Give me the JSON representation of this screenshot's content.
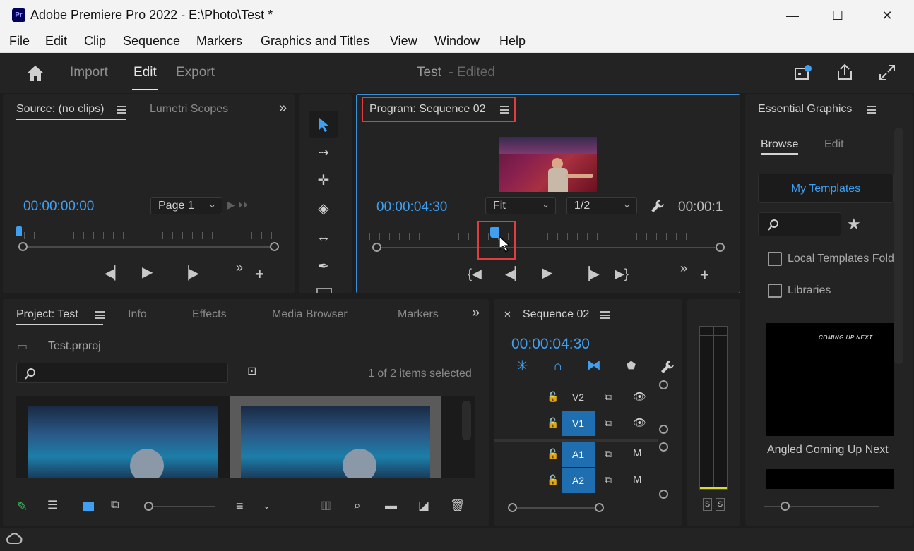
{
  "window": {
    "title": "Adobe Premiere Pro 2022 - E:\\Photo\\Test *",
    "logo": "Pr",
    "minimize": "—",
    "maximize": "☐",
    "close": "✕"
  },
  "menu": [
    "File",
    "Edit",
    "Clip",
    "Sequence",
    "Markers",
    "Graphics and Titles",
    "View",
    "Window",
    "Help"
  ],
  "header": {
    "tabs": [
      "Import",
      "Edit",
      "Export"
    ],
    "active_tab": "Edit",
    "doc_title": "Test",
    "doc_status": "- Edited"
  },
  "source_panel": {
    "tab": "Source: (no clips)",
    "tab2": "Lumetri Scopes",
    "timecode": "00:00:00:00",
    "page_select": "Page 1"
  },
  "program_panel": {
    "tab": "Program: Sequence 02",
    "timecode": "00:00:04:30",
    "fit": "Fit",
    "resolution": "1/2",
    "end_timecode": "00:00:1"
  },
  "essential_graphics": {
    "title": "Essential Graphics",
    "tabs": [
      "Browse",
      "Edit"
    ],
    "my_templates": "My Templates",
    "local_templates": "Local Templates Fold",
    "libraries": "Libraries",
    "template_name": "Angled Coming Up Next",
    "thumb_text": "COMING UP NEXT"
  },
  "project_panel": {
    "tabs": [
      "Project: Test",
      "Info",
      "Effects",
      "Media Browser",
      "Markers"
    ],
    "file": "Test.prproj",
    "selection": "1 of 2 items selected"
  },
  "timeline": {
    "tab": "Sequence 02",
    "timecode": "00:00:04:30",
    "tracks": [
      {
        "name": "V2",
        "icon2": "eye-icon",
        "glyph2": "👁",
        "highlight": false
      },
      {
        "name": "V1",
        "icon2": "eye-icon",
        "glyph2": "👁",
        "highlight": true
      },
      {
        "name": "A1",
        "icon2": "mute-toggle",
        "glyph2": "M",
        "highlight": true
      },
      {
        "name": "A2",
        "icon2": "mute-toggle",
        "glyph2": "M",
        "highlight": true
      }
    ]
  },
  "audio_meter": {
    "solo_left": "S",
    "solo_right": "S"
  },
  "colors": {
    "accent": "#3fa0f2",
    "highlight_box": "#e33c3c",
    "track_blue": "#1f6fb0"
  }
}
